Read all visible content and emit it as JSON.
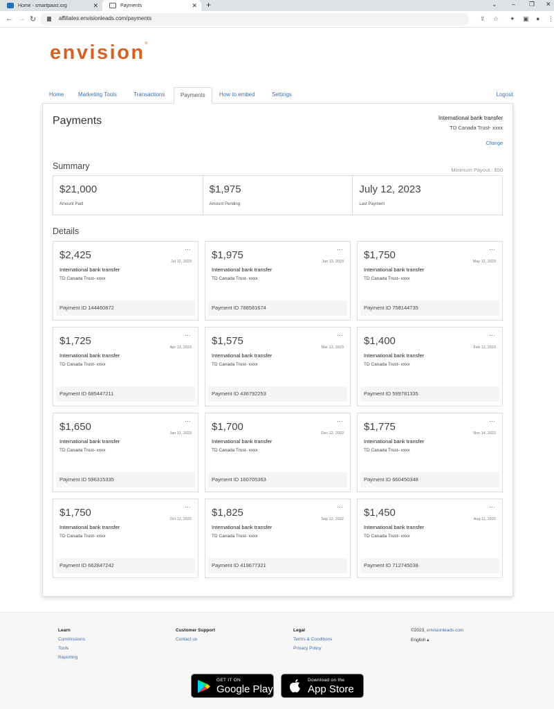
{
  "browser": {
    "tabs": [
      {
        "label": "Home - smartpawz.org"
      },
      {
        "label": "Payments"
      }
    ],
    "url": "affiliates.envisionleads.com/payments"
  },
  "brand": {
    "logo": "envision",
    "accent": "#d46125",
    "link_color": "#3f6ea7"
  },
  "nav": {
    "items": [
      {
        "label": "Home"
      },
      {
        "label": "Marketing Tools"
      },
      {
        "label": "Transactions"
      },
      {
        "label": "Payments"
      },
      {
        "label": "How to embed"
      },
      {
        "label": "Settings"
      }
    ],
    "logout": "Logout"
  },
  "page": {
    "title": "Payments",
    "payment_method": "International bank transfer",
    "payment_bank": "TD Canada Trust- xxxx",
    "change": "Change",
    "summary_heading": "Summary",
    "min_payout": "Minimum Payout : $50",
    "summary": [
      {
        "value": "$21,000",
        "label": "Amount Paid"
      },
      {
        "value": "$1,975",
        "label": "Amount Pending"
      },
      {
        "value": "July 12, 2023",
        "label": "Last Payment"
      }
    ],
    "details_heading": "Details",
    "payments": [
      {
        "amount": "$2,425",
        "date": "Jul 12, 2023",
        "method": "International bank transfer",
        "bank": "TD Canada Trust- xxxx",
        "id": "Payment ID 144460872"
      },
      {
        "amount": "$1,975",
        "date": "Jun 13, 2023",
        "method": "International bank transfer",
        "bank": "TD Canada Trust- xxxx",
        "id": "Payment ID 788581674"
      },
      {
        "amount": "$1,750",
        "date": "May 12, 2023",
        "method": "International bank transfer",
        "bank": "TD Canada Trust- xxxx",
        "id": "Payment ID 758144735"
      },
      {
        "amount": "$1,725",
        "date": "Apr 13, 2023",
        "method": "International bank transfer",
        "bank": "TD Canada Trust- xxxx",
        "id": "Payment ID 685447211"
      },
      {
        "amount": "$1,575",
        "date": "Mar 13, 2023",
        "method": "International bank transfer",
        "bank": "TD Canada Trust- xxxx",
        "id": "Payment ID 436792253"
      },
      {
        "amount": "$1,400",
        "date": "Feb 12, 2023",
        "method": "International bank transfer",
        "bank": "TD Canada Trust- xxxx",
        "id": "Payment ID 599781335"
      },
      {
        "amount": "$1,650",
        "date": "Jan 13, 2023",
        "method": "International bank transfer",
        "bank": "TD Canada Trust- xxxx",
        "id": "Payment ID 596315335"
      },
      {
        "amount": "$1,700",
        "date": "Dec 12, 2022",
        "method": "International bank transfer",
        "bank": "TD Canada Trust- xxxx",
        "id": "Payment ID 160705363"
      },
      {
        "amount": "$1,775",
        "date": "Nov 14, 2022",
        "method": "International bank transfer",
        "bank": "TD Canada Trust- xxxx",
        "id": "Payment ID 660450348"
      },
      {
        "amount": "$1,750",
        "date": "Oct 12, 2022",
        "method": "International bank transfer",
        "bank": "TD Canada Trust- xxxx",
        "id": "Payment ID 662847242"
      },
      {
        "amount": "$1,825",
        "date": "Sep 12, 2022",
        "method": "International bank transfer",
        "bank": "TD Canada Trust- xxxx",
        "id": "Payment ID 419677321"
      },
      {
        "amount": "$1,450",
        "date": "Aug 11, 2022",
        "method": "International bank transfer",
        "bank": "TD Canada Trust- xxxx",
        "id": "Payment ID 712745038"
      }
    ]
  },
  "footer": {
    "learn": {
      "heading": "Learn",
      "links": [
        "Commissions",
        "Tools",
        "Reporting"
      ]
    },
    "support": {
      "heading": "Customer Support",
      "links": [
        "Contact us"
      ]
    },
    "legal": {
      "heading": "Legal",
      "links": [
        "Terms & Conditions",
        "Privacy Policy"
      ]
    },
    "copyright_prefix": "©2023,",
    "copyright_link": "envisionleads.com",
    "language": "English ▴",
    "google_play": {
      "small": "GET IT ON",
      "big": "Google Play"
    },
    "app_store": {
      "small": "Download on the",
      "big": "App Store"
    }
  }
}
